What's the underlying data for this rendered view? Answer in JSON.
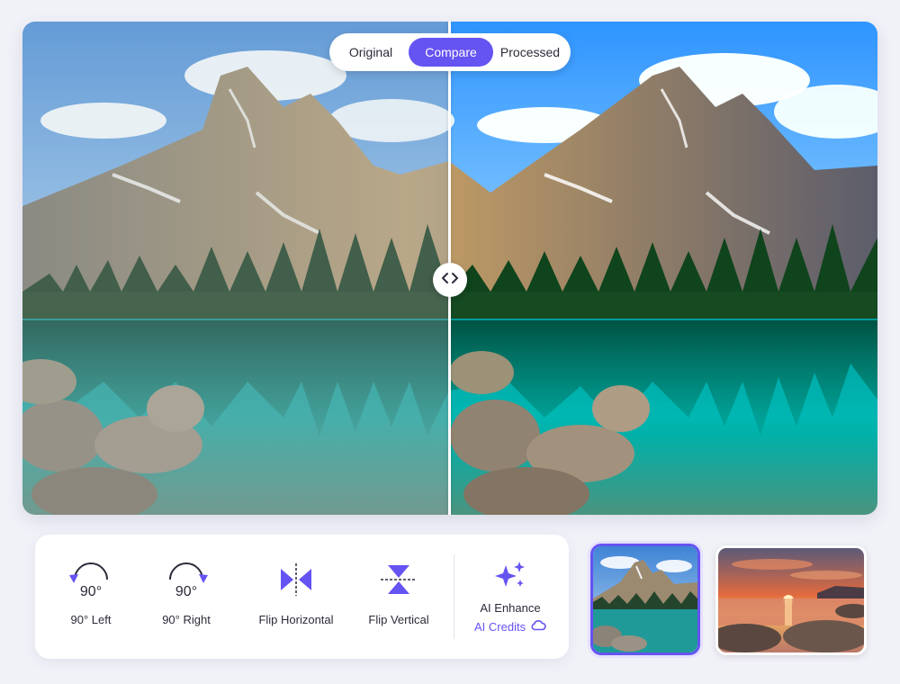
{
  "viewer": {
    "modes": {
      "original": "Original",
      "compare": "Compare",
      "processed": "Processed",
      "active": "compare"
    },
    "handle_icon": "chevrons-left-right-icon"
  },
  "toolbar": {
    "rotate_left": {
      "icon_text": "90°",
      "label": "90° Left",
      "icon": "rotate-left-icon"
    },
    "rotate_right": {
      "icon_text": "90°",
      "label": "90° Right",
      "icon": "rotate-right-icon"
    },
    "flip_horizontal": {
      "label": "Flip Horizontal",
      "icon": "flip-horizontal-icon"
    },
    "flip_vertical": {
      "label": "Flip Vertical",
      "icon": "flip-vertical-icon"
    },
    "ai_enhance": {
      "label": "AI Enhance",
      "credits_label": "AI Credits",
      "icon": "sparkles-icon",
      "credits_icon": "cloud-icon"
    }
  },
  "thumbnails": [
    {
      "name": "mountain-lake",
      "selected": true
    },
    {
      "name": "sunset-beach",
      "selected": false
    }
  ],
  "colors": {
    "accent": "#6553f2",
    "background": "#f1f1f8",
    "panel": "#ffffff"
  }
}
